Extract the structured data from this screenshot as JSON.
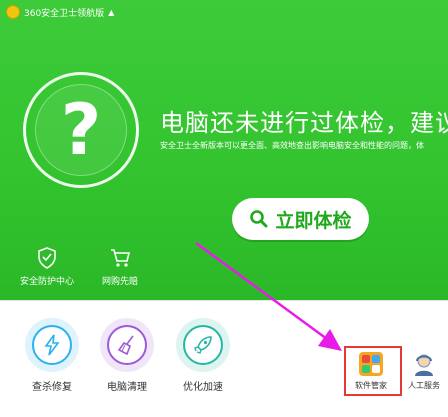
{
  "window": {
    "title": "360安全卫士领航版"
  },
  "hero": {
    "headline": "电脑还未进行过体检，建议立",
    "subline": "安全卫士全新版本可以更全面、高效地查出影响电脑安全和性能的问题，体",
    "status_glyph": "?",
    "check_button": "立即体检"
  },
  "shortcuts": [
    {
      "label": "安全防护中心",
      "icon": "shield-check-icon"
    },
    {
      "label": "网购先赔",
      "icon": "shopping-cart-icon"
    }
  ],
  "tools": [
    {
      "label": "查杀修复",
      "icon": "lightning-icon",
      "color": "#2bb0f0"
    },
    {
      "label": "电脑清理",
      "icon": "broom-icon",
      "color": "#9c5ad8"
    },
    {
      "label": "优化加速",
      "icon": "rocket-icon",
      "color": "#27b7a4"
    }
  ],
  "small_tools": [
    {
      "label": "软件管家",
      "icon": "software-manager-icon"
    },
    {
      "label": "人工服务",
      "icon": "support-agent-icon"
    }
  ],
  "colors": {
    "brand_green": "#33c42f",
    "highlight_red": "#e53935",
    "annotation_magenta": "#e81ce8"
  }
}
